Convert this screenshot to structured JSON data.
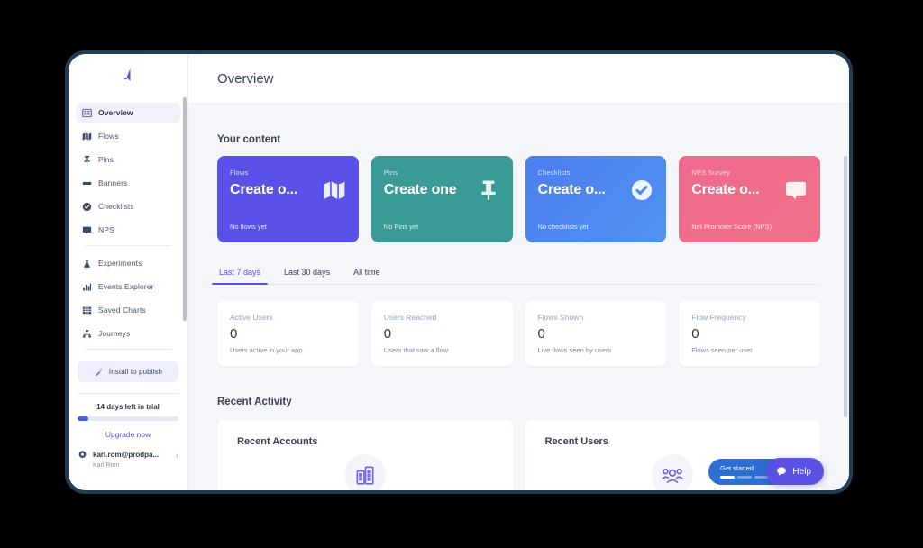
{
  "app": {
    "logo_icon": "chameleon-logo-icon"
  },
  "sidebar": {
    "nav_primary": [
      {
        "label": "Overview",
        "icon": "grid-dashboard-icon",
        "active": true
      },
      {
        "label": "Flows",
        "icon": "map-icon",
        "active": false
      },
      {
        "label": "Pins",
        "icon": "pin-icon",
        "active": false
      },
      {
        "label": "Banners",
        "icon": "banner-icon",
        "active": false
      },
      {
        "label": "Checklists",
        "icon": "check-circle-icon",
        "active": false
      },
      {
        "label": "NPS",
        "icon": "speech-bubble-icon",
        "active": false
      }
    ],
    "nav_secondary": [
      {
        "label": "Experiments",
        "icon": "flask-icon"
      },
      {
        "label": "Events Explorer",
        "icon": "bar-chart-icon"
      },
      {
        "label": "Saved Charts",
        "icon": "table-grid-icon"
      },
      {
        "label": "Journeys",
        "icon": "journey-nodes-icon"
      }
    ],
    "install_button": {
      "label": "Install to publish",
      "icon": "magic-wand-icon"
    },
    "trial": {
      "text": "14 days left in trial",
      "progress_percent": 11,
      "upgrade_label": "Upgrade now"
    },
    "account": {
      "email": "karl.rom@prodpa...",
      "name": "Karl Rom",
      "gear_icon": "gear-icon",
      "chevron_icon": "chevron-right-icon"
    }
  },
  "header": {
    "title": "Overview"
  },
  "main": {
    "your_content_title": "Your content",
    "content_cards": [
      {
        "kicker": "Flows",
        "title": "Create o...",
        "subtitle": "No flows yet",
        "icon": "map-icon",
        "color": "#5a52e8"
      },
      {
        "kicker": "Pins",
        "title": "Create one",
        "subtitle": "No Pins yet",
        "icon": "pin-icon",
        "color": "#3a9b96"
      },
      {
        "kicker": "Checklists",
        "title": "Create o...",
        "subtitle": "No checklists yet",
        "icon": "check-circle-icon",
        "color": "#4d86ef"
      },
      {
        "kicker": "NPS Survey",
        "title": "Create o...",
        "subtitle": "Net Promoter Score (NPS)",
        "icon": "speech-bubble-icon",
        "color": "#ee6e92"
      }
    ],
    "tabs": [
      {
        "label": "Last 7 days",
        "active": true
      },
      {
        "label": "Last 30 days",
        "active": false
      },
      {
        "label": "All time",
        "active": false
      }
    ],
    "stat_cards": [
      {
        "label": "Active Users",
        "value": "0",
        "sub": "Users active in your app"
      },
      {
        "label": "Users Reached",
        "value": "0",
        "sub": "Users that saw a flow"
      },
      {
        "label": "Flows Shown",
        "value": "0",
        "sub": "Live flows seen by users"
      },
      {
        "label": "Flow Frequency",
        "value": "0",
        "sub": "Flows seen per user"
      }
    ],
    "recent_activity_title": "Recent Activity",
    "activity_cards": [
      {
        "title": "Recent Accounts",
        "icon": "buildings-icon"
      },
      {
        "title": "Recent Users",
        "icon": "people-group-icon"
      }
    ]
  },
  "widgets": {
    "get_started": {
      "label": "Get started",
      "segments_total": 4,
      "segments_filled": 1,
      "color": "#2e6fd4"
    },
    "help": {
      "label": "Help",
      "icon": "chat-bubble-icon",
      "color": "#5b52e5"
    }
  },
  "theme": {
    "accent": "#5b52e5",
    "page_bg": "#f5f6fa",
    "frame": "#223d52"
  }
}
